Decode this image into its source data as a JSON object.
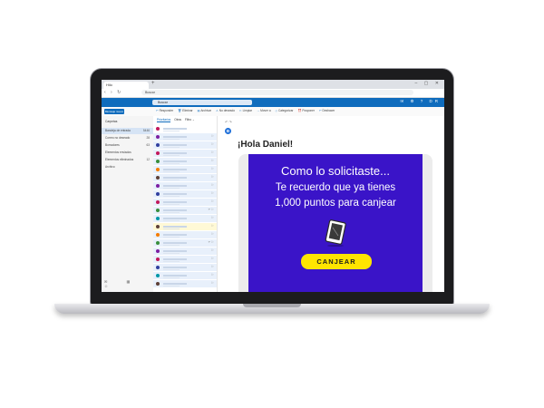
{
  "browser": {
    "tab_title": "Hilo",
    "address": "Buscar",
    "nav_icons": "‹ › ↻",
    "window_controls": "– ▢ ✕"
  },
  "outlook": {
    "search_placeholder": "Buscar",
    "header_icons": "✉ ⚙ ? DR",
    "accent": "#0f6cbd",
    "new_message": "Mensaje nuevo",
    "toolbar": [
      {
        "icon": "↶",
        "label": "Responder"
      },
      {
        "icon": "🗑",
        "label": "Eliminar"
      },
      {
        "icon": "▤",
        "label": "Archivar"
      },
      {
        "icon": "⚠",
        "label": "No deseado"
      },
      {
        "icon": "✂",
        "label": "Limpiar"
      },
      {
        "icon": "→",
        "label": "Mover a"
      },
      {
        "icon": "◇",
        "label": "Categorizar"
      },
      {
        "icon": "⏰",
        "label": "Posponer"
      },
      {
        "icon": "↶",
        "label": "Deshacer"
      }
    ],
    "folders_heading": "Carpetas",
    "folders": [
      {
        "label": "Bandeja de entrada",
        "count": "5446",
        "selected": true
      },
      {
        "label": "Correo no deseado",
        "count": "28",
        "selected": false
      },
      {
        "label": "Borradores",
        "count": "63",
        "selected": false
      },
      {
        "label": "Elementos enviados",
        "count": "",
        "selected": false
      },
      {
        "label": "Elementos eliminados",
        "count": "12",
        "selected": false
      },
      {
        "label": "Archivo",
        "count": "",
        "selected": false
      }
    ],
    "folder_footer_icons": "✉ ▦ ☺",
    "list_tabs": [
      "Prioritarios",
      "Otros"
    ],
    "list_filter": "Filtro ⌄",
    "email_rows": [
      {
        "color": "#c2185b",
        "style": "plain",
        "icons": ""
      },
      {
        "color": "#7b1fa2",
        "style": "sel",
        "icons": "⚐"
      },
      {
        "color": "#303f9f",
        "style": "sel",
        "icons": "⚐"
      },
      {
        "color": "#c2185b",
        "style": "sel",
        "icons": "⚐"
      },
      {
        "color": "#388e3c",
        "style": "sel",
        "icons": "⚐"
      },
      {
        "color": "#f57c00",
        "style": "sel",
        "icons": "⚐"
      },
      {
        "color": "#5d4037",
        "style": "sel",
        "icons": "⚐"
      },
      {
        "color": "#7b1fa2",
        "style": "sel",
        "icons": "⚐"
      },
      {
        "color": "#303f9f",
        "style": "sel",
        "icons": "⚐"
      },
      {
        "color": "#c2185b",
        "style": "sel",
        "icons": "⚐"
      },
      {
        "color": "#388e3c",
        "style": "sel",
        "icons": "↶ ⚐"
      },
      {
        "color": "#0097a7",
        "style": "sel",
        "icons": "⚐"
      },
      {
        "color": "#5d4037",
        "style": "hl",
        "icons": "⚐"
      },
      {
        "color": "#f57c00",
        "style": "sel",
        "icons": "⚐"
      },
      {
        "color": "#388e3c",
        "style": "sel",
        "icons": "↶ ⚐"
      },
      {
        "color": "#7b1fa2",
        "style": "sel",
        "icons": "⚐"
      },
      {
        "color": "#c2185b",
        "style": "sel",
        "icons": "⚐"
      },
      {
        "color": "#303f9f",
        "style": "sel",
        "icons": "⚐"
      },
      {
        "color": "#0097a7",
        "style": "sel",
        "icons": "⚐"
      },
      {
        "color": "#5d4037",
        "style": "sel",
        "icons": "⚐"
      }
    ],
    "reading": {
      "sender_initial": "B",
      "reply_icons": "↶ ↷",
      "greeting": "¡Hola Daniel!",
      "promo": {
        "bg_color": "#3a14c8",
        "title": "Como lo solicitaste...",
        "line1": "Te recuerdo que ya tienes",
        "line2": "1,000 puntos para canjear",
        "tablet_icon": "tablet-icon",
        "cta": "CANJEAR",
        "cta_color": "#ffe500"
      }
    }
  }
}
